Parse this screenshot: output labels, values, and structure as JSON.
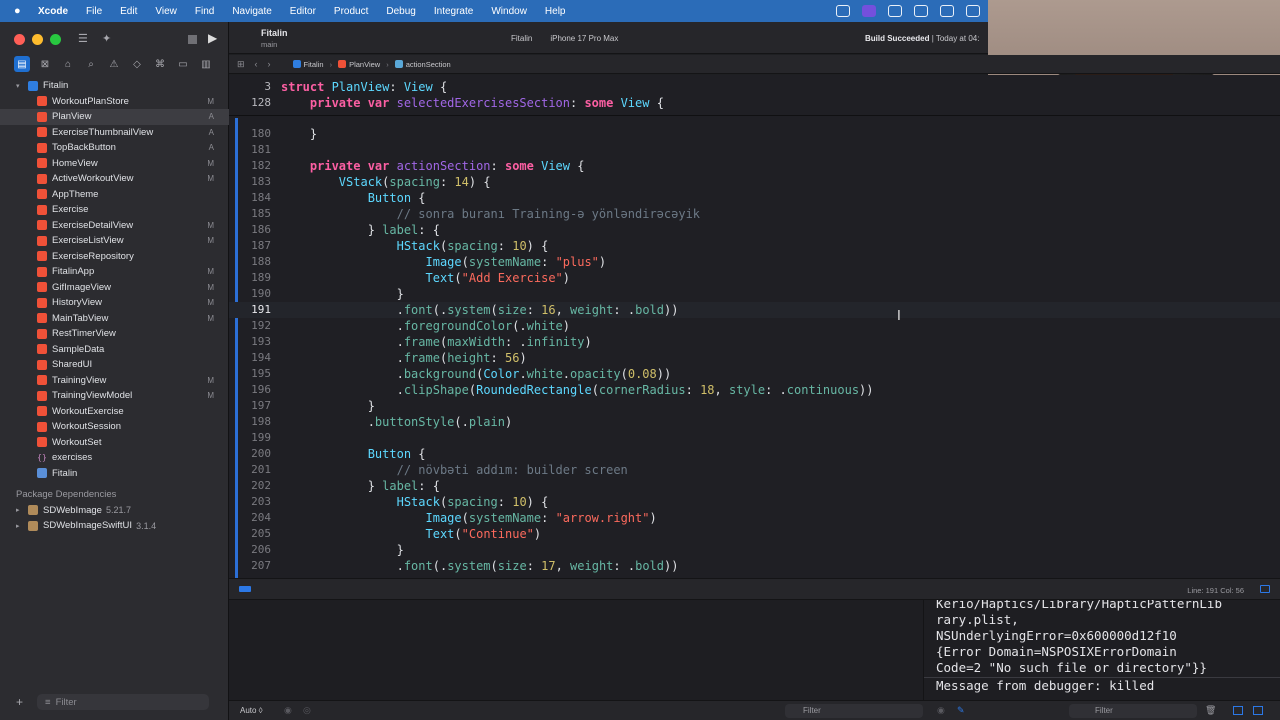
{
  "menubar": {
    "apple": "",
    "app_name": "Xcode",
    "items": [
      "File",
      "Edit",
      "View",
      "Find",
      "Navigate",
      "Editor",
      "Product",
      "Debug",
      "Integrate",
      "Window",
      "Help"
    ]
  },
  "toolbar": {
    "scheme_name": "Fitalin",
    "branch": "main",
    "destination_scheme": "Fitalin",
    "destination_device": "iPhone 17 Pro Max",
    "build_status_bold": "Build Succeeded",
    "build_status_time": "| Today at 04:"
  },
  "navigator": {
    "root": "Fitalin",
    "items": [
      {
        "name": "WorkoutPlanStore",
        "badge": "M",
        "icon": "swift-icon"
      },
      {
        "name": "PlanView",
        "badge": "A",
        "icon": "swift-icon",
        "selected": true
      },
      {
        "name": "ExerciseThumbnailView",
        "badge": "A",
        "icon": "swift-icon"
      },
      {
        "name": "TopBackButton",
        "badge": "A",
        "icon": "swift-icon"
      },
      {
        "name": "HomeView",
        "badge": "M",
        "icon": "swift-icon"
      },
      {
        "name": "ActiveWorkoutView",
        "badge": "M",
        "icon": "swift-icon"
      },
      {
        "name": "AppTheme",
        "badge": "",
        "icon": "swift-icon"
      },
      {
        "name": "Exercise",
        "badge": "",
        "icon": "swift-icon"
      },
      {
        "name": "ExerciseDetailView",
        "badge": "M",
        "icon": "swift-icon"
      },
      {
        "name": "ExerciseListView",
        "badge": "M",
        "icon": "swift-icon"
      },
      {
        "name": "ExerciseRepository",
        "badge": "",
        "icon": "swift-icon"
      },
      {
        "name": "FitalinApp",
        "badge": "M",
        "icon": "swift-icon"
      },
      {
        "name": "GifImageView",
        "badge": "M",
        "icon": "swift-icon"
      },
      {
        "name": "HistoryView",
        "badge": "M",
        "icon": "swift-icon"
      },
      {
        "name": "MainTabView",
        "badge": "M",
        "icon": "swift-icon"
      },
      {
        "name": "RestTimerView",
        "badge": "",
        "icon": "swift-icon"
      },
      {
        "name": "SampleData",
        "badge": "",
        "icon": "swift-icon"
      },
      {
        "name": "SharedUI",
        "badge": "",
        "icon": "swift-icon"
      },
      {
        "name": "TrainingView",
        "badge": "M",
        "icon": "swift-icon"
      },
      {
        "name": "TrainingViewModel",
        "badge": "M",
        "icon": "swift-icon"
      },
      {
        "name": "WorkoutExercise",
        "badge": "",
        "icon": "swift-icon"
      },
      {
        "name": "WorkoutSession",
        "badge": "",
        "icon": "swift-icon"
      },
      {
        "name": "WorkoutSet",
        "badge": "",
        "icon": "swift-icon"
      },
      {
        "name": "exercises",
        "badge": "",
        "icon": "json-icon"
      },
      {
        "name": "Fitalin",
        "badge": "",
        "icon": "asset-icon"
      }
    ],
    "package_header": "Package Dependencies",
    "packages": [
      {
        "name": "SDWebImage",
        "version": "5.21.7"
      },
      {
        "name": "SDWebImageSwiftUI",
        "version": "3.1.4"
      }
    ],
    "filter_placeholder": "Filter"
  },
  "jumpbar": {
    "crumbs": [
      "Fitalin",
      "PlanView",
      "actionSection"
    ]
  },
  "editor": {
    "current_line": "191",
    "line_col": "Line: 191  Col: 56",
    "sticky": [
      {
        "n": "3",
        "tokens": [
          [
            "kw",
            "struct "
          ],
          [
            "ty",
            "PlanView"
          ],
          [
            "pl",
            ": "
          ],
          [
            "ty",
            "View"
          ],
          [
            "pl",
            " {"
          ]
        ]
      },
      {
        "n": "128",
        "tokens": [
          [
            "pl",
            "    "
          ],
          [
            "kw",
            "private var "
          ],
          [
            "pn",
            "selectedExercisesSection"
          ],
          [
            "pl",
            ": "
          ],
          [
            "kw",
            "some "
          ],
          [
            "ty",
            "View"
          ],
          [
            "pl",
            " {"
          ]
        ]
      }
    ],
    "lines": [
      {
        "n": "180",
        "tokens": [
          [
            "pl",
            "    }"
          ]
        ]
      },
      {
        "n": "181",
        "tokens": [
          [
            "pl",
            ""
          ]
        ]
      },
      {
        "n": "182",
        "tokens": [
          [
            "pl",
            "    "
          ],
          [
            "kw",
            "private var "
          ],
          [
            "pn",
            "actionSection"
          ],
          [
            "pl",
            ": "
          ],
          [
            "kw",
            "some "
          ],
          [
            "ty",
            "View"
          ],
          [
            "pl",
            " {"
          ]
        ]
      },
      {
        "n": "183",
        "tokens": [
          [
            "pl",
            "        "
          ],
          [
            "ty",
            "VStack"
          ],
          [
            "pl",
            "("
          ],
          [
            "fn",
            "spacing"
          ],
          [
            "pl",
            ": "
          ],
          [
            "nm",
            "14"
          ],
          [
            "pl",
            ") {"
          ]
        ]
      },
      {
        "n": "184",
        "tokens": [
          [
            "pl",
            "            "
          ],
          [
            "ty",
            "Button"
          ],
          [
            "pl",
            " {"
          ]
        ]
      },
      {
        "n": "185",
        "tokens": [
          [
            "pl",
            "                "
          ],
          [
            "cm",
            "// sonra buranı Training-ə yönləndirəcəyik"
          ]
        ]
      },
      {
        "n": "186",
        "tokens": [
          [
            "pl",
            "            } "
          ],
          [
            "fn",
            "label"
          ],
          [
            "pl",
            ": {"
          ]
        ]
      },
      {
        "n": "187",
        "tokens": [
          [
            "pl",
            "                "
          ],
          [
            "ty",
            "HStack"
          ],
          [
            "pl",
            "("
          ],
          [
            "fn",
            "spacing"
          ],
          [
            "pl",
            ": "
          ],
          [
            "nm",
            "10"
          ],
          [
            "pl",
            ") {"
          ]
        ]
      },
      {
        "n": "188",
        "tokens": [
          [
            "pl",
            "                    "
          ],
          [
            "ty",
            "Image"
          ],
          [
            "pl",
            "("
          ],
          [
            "fn",
            "systemName"
          ],
          [
            "pl",
            ": "
          ],
          [
            "st",
            "\"plus\""
          ],
          [
            "pl",
            ")"
          ]
        ]
      },
      {
        "n": "189",
        "tokens": [
          [
            "pl",
            "                    "
          ],
          [
            "ty",
            "Text"
          ],
          [
            "pl",
            "("
          ],
          [
            "st",
            "\"Add Exercise\""
          ],
          [
            "pl",
            ")"
          ]
        ]
      },
      {
        "n": "190",
        "tokens": [
          [
            "pl",
            "                }"
          ]
        ]
      },
      {
        "n": "191",
        "tokens": [
          [
            "pl",
            "                ."
          ],
          [
            "fn",
            "font"
          ],
          [
            "pl",
            "(."
          ],
          [
            "fn",
            "system"
          ],
          [
            "pl",
            "("
          ],
          [
            "fn",
            "size"
          ],
          [
            "pl",
            ": "
          ],
          [
            "nm",
            "16"
          ],
          [
            "pl",
            ", "
          ],
          [
            "fn",
            "weight"
          ],
          [
            "pl",
            ": ."
          ],
          [
            "fn",
            "bold"
          ],
          [
            "pl",
            "))"
          ]
        ]
      },
      {
        "n": "192",
        "tokens": [
          [
            "pl",
            "                ."
          ],
          [
            "fn",
            "foregroundColor"
          ],
          [
            "pl",
            "(."
          ],
          [
            "fn",
            "white"
          ],
          [
            "pl",
            ")"
          ]
        ]
      },
      {
        "n": "193",
        "tokens": [
          [
            "pl",
            "                ."
          ],
          [
            "fn",
            "frame"
          ],
          [
            "pl",
            "("
          ],
          [
            "fn",
            "maxWidth"
          ],
          [
            "pl",
            ": ."
          ],
          [
            "fn",
            "infinity"
          ],
          [
            "pl",
            ")"
          ]
        ]
      },
      {
        "n": "194",
        "tokens": [
          [
            "pl",
            "                ."
          ],
          [
            "fn",
            "frame"
          ],
          [
            "pl",
            "("
          ],
          [
            "fn",
            "height"
          ],
          [
            "pl",
            ": "
          ],
          [
            "nm",
            "56"
          ],
          [
            "pl",
            ")"
          ]
        ]
      },
      {
        "n": "195",
        "tokens": [
          [
            "pl",
            "                ."
          ],
          [
            "fn",
            "background"
          ],
          [
            "pl",
            "("
          ],
          [
            "ty",
            "Color"
          ],
          [
            "pl",
            "."
          ],
          [
            "fn",
            "white"
          ],
          [
            "pl",
            "."
          ],
          [
            "fn",
            "opacity"
          ],
          [
            "pl",
            "("
          ],
          [
            "nm",
            "0.08"
          ],
          [
            "pl",
            "))"
          ]
        ]
      },
      {
        "n": "196",
        "tokens": [
          [
            "pl",
            "                ."
          ],
          [
            "fn",
            "clipShape"
          ],
          [
            "pl",
            "("
          ],
          [
            "ty",
            "RoundedRectangle"
          ],
          [
            "pl",
            "("
          ],
          [
            "fn",
            "cornerRadius"
          ],
          [
            "pl",
            ": "
          ],
          [
            "nm",
            "18"
          ],
          [
            "pl",
            ", "
          ],
          [
            "fn",
            "style"
          ],
          [
            "pl",
            ": ."
          ],
          [
            "fn",
            "continuous"
          ],
          [
            "pl",
            "))"
          ]
        ]
      },
      {
        "n": "197",
        "tokens": [
          [
            "pl",
            "            }"
          ]
        ]
      },
      {
        "n": "198",
        "tokens": [
          [
            "pl",
            "            ."
          ],
          [
            "fn",
            "buttonStyle"
          ],
          [
            "pl",
            "(."
          ],
          [
            "fn",
            "plain"
          ],
          [
            "pl",
            ")"
          ]
        ]
      },
      {
        "n": "199",
        "tokens": [
          [
            "pl",
            ""
          ]
        ]
      },
      {
        "n": "200",
        "tokens": [
          [
            "pl",
            "            "
          ],
          [
            "ty",
            "Button"
          ],
          [
            "pl",
            " {"
          ]
        ]
      },
      {
        "n": "201",
        "tokens": [
          [
            "pl",
            "                "
          ],
          [
            "cm",
            "// növbəti addım: builder screen"
          ]
        ]
      },
      {
        "n": "202",
        "tokens": [
          [
            "pl",
            "            } "
          ],
          [
            "fn",
            "label"
          ],
          [
            "pl",
            ": {"
          ]
        ]
      },
      {
        "n": "203",
        "tokens": [
          [
            "pl",
            "                "
          ],
          [
            "ty",
            "HStack"
          ],
          [
            "pl",
            "("
          ],
          [
            "fn",
            "spacing"
          ],
          [
            "pl",
            ": "
          ],
          [
            "nm",
            "10"
          ],
          [
            "pl",
            ") {"
          ]
        ]
      },
      {
        "n": "204",
        "tokens": [
          [
            "pl",
            "                    "
          ],
          [
            "ty",
            "Image"
          ],
          [
            "pl",
            "("
          ],
          [
            "fn",
            "systemName"
          ],
          [
            "pl",
            ": "
          ],
          [
            "st",
            "\"arrow.right\""
          ],
          [
            "pl",
            ")"
          ]
        ]
      },
      {
        "n": "205",
        "tokens": [
          [
            "pl",
            "                    "
          ],
          [
            "ty",
            "Text"
          ],
          [
            "pl",
            "("
          ],
          [
            "st",
            "\"Continue\""
          ],
          [
            "pl",
            ")"
          ]
        ]
      },
      {
        "n": "206",
        "tokens": [
          [
            "pl",
            "                }"
          ]
        ]
      },
      {
        "n": "207",
        "tokens": [
          [
            "pl",
            "                ."
          ],
          [
            "fn",
            "font"
          ],
          [
            "pl",
            "(."
          ],
          [
            "fn",
            "system"
          ],
          [
            "pl",
            "("
          ],
          [
            "fn",
            "size"
          ],
          [
            "pl",
            ": "
          ],
          [
            "nm",
            "17"
          ],
          [
            "pl",
            ", "
          ],
          [
            "fn",
            "weight"
          ],
          [
            "pl",
            ": ."
          ],
          [
            "fn",
            "bold"
          ],
          [
            "pl",
            "))"
          ]
        ]
      }
    ]
  },
  "console": {
    "lines": [
      "Kerio/Haptics/Library/HapticPatternLib",
      "rary.plist,",
      "NSUnderlyingError=0x600000d12f10",
      "{Error Domain=NSPOSIXErrorDomain",
      "Code=2 \"No such file or directory\"}}"
    ],
    "last": "Message from debugger: killed"
  },
  "debug_bar": {
    "auto_label": "Auto ◊",
    "filter_left": "Filter",
    "filter_right": "Filter"
  }
}
